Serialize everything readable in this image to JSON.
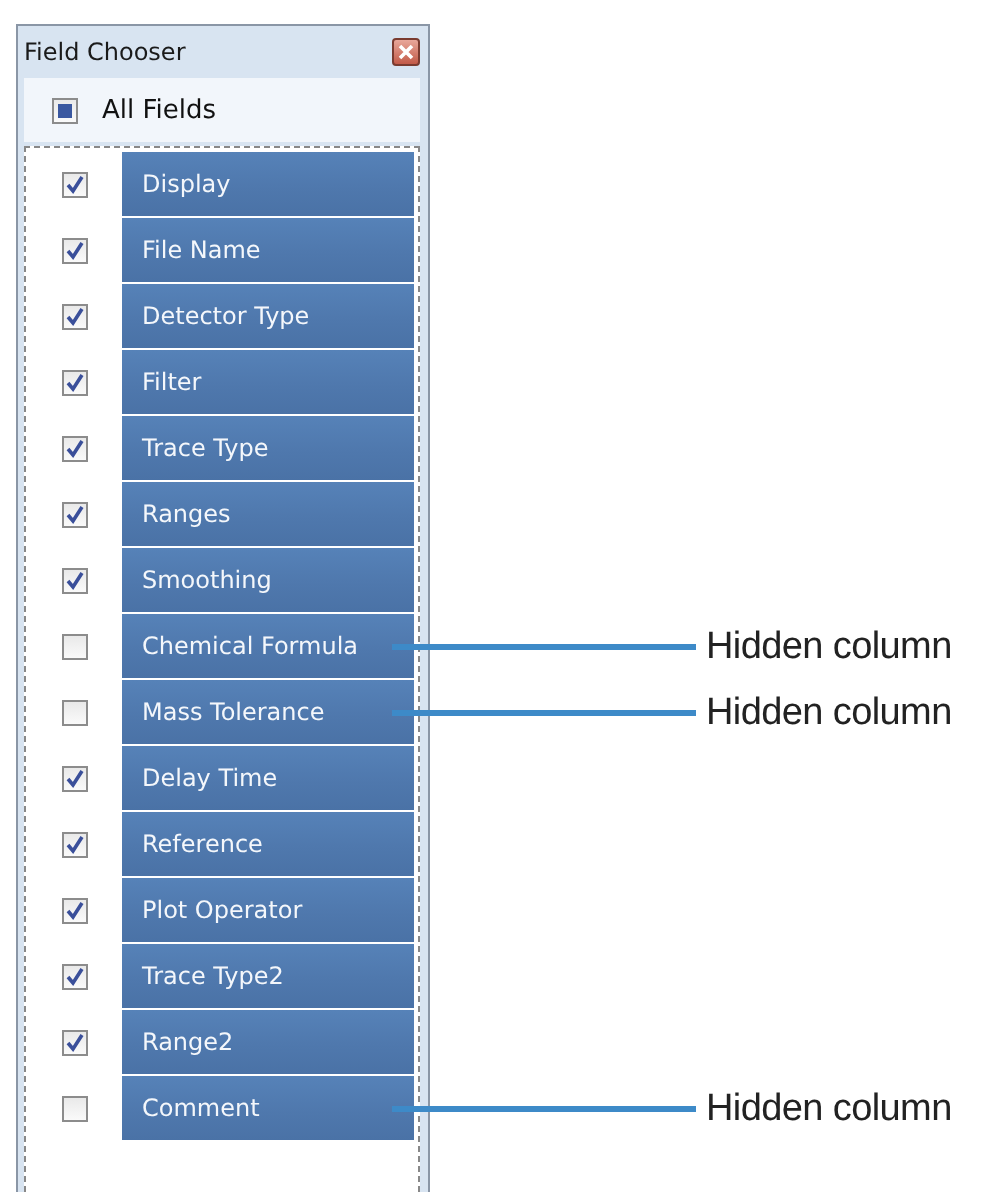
{
  "window": {
    "title": "Field Chooser"
  },
  "all_fields": {
    "label": "All Fields",
    "indeterminate": true
  },
  "fields": [
    {
      "label": "Display",
      "checked": true
    },
    {
      "label": "File Name",
      "checked": true
    },
    {
      "label": "Detector Type",
      "checked": true
    },
    {
      "label": "Filter",
      "checked": true
    },
    {
      "label": "Trace Type",
      "checked": true
    },
    {
      "label": "Ranges",
      "checked": true
    },
    {
      "label": "Smoothing",
      "checked": true
    },
    {
      "label": "Chemical Formula",
      "checked": false,
      "annotation": "Hidden column"
    },
    {
      "label": "Mass Tolerance",
      "checked": false,
      "annotation": "Hidden column"
    },
    {
      "label": "Delay Time",
      "checked": true
    },
    {
      "label": "Reference",
      "checked": true
    },
    {
      "label": "Plot Operator",
      "checked": true
    },
    {
      "label": "Trace Type2",
      "checked": true
    },
    {
      "label": "Range2",
      "checked": true
    },
    {
      "label": "Comment",
      "checked": false,
      "annotation": "Hidden column"
    }
  ]
}
